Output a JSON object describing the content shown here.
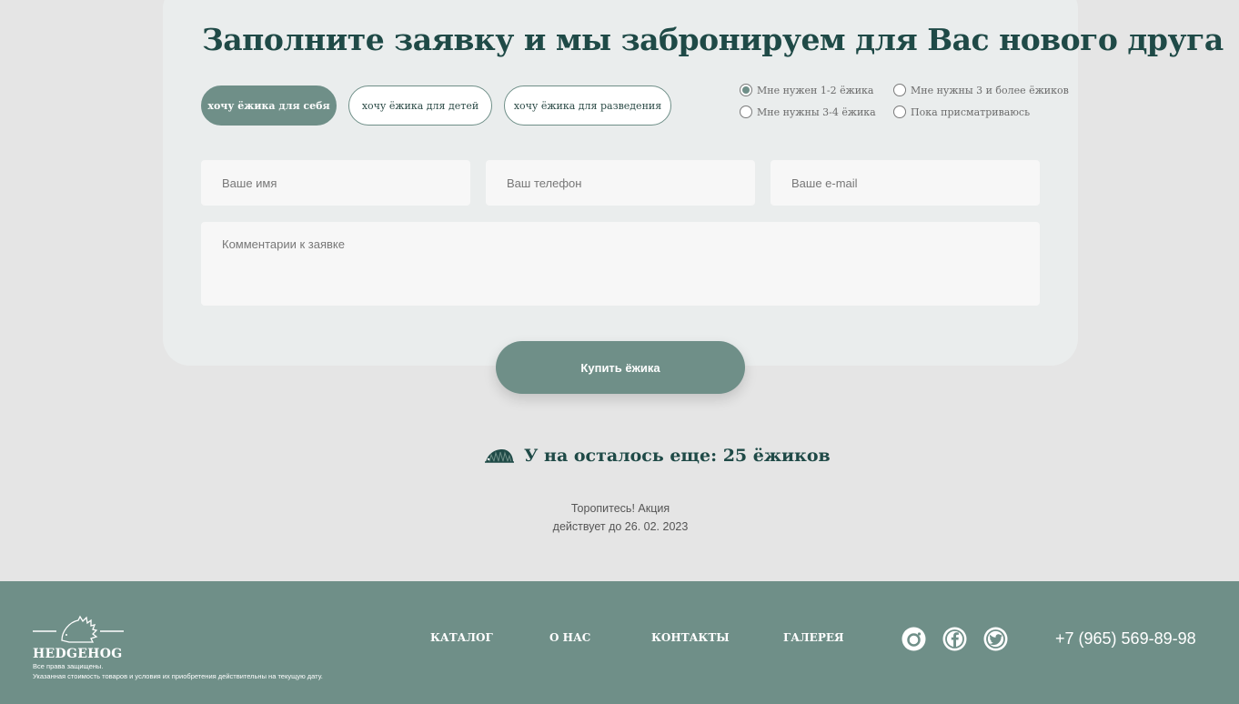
{
  "form": {
    "title": "Заполните заявку и мы забронируем для Вас нового друга",
    "purpose_buttons": [
      {
        "label": "хочу ёжика для себя",
        "active": true
      },
      {
        "label": "хочу ёжика для детей",
        "active": false
      },
      {
        "label": "хочу ёжика для разведения",
        "active": false
      }
    ],
    "quantity_options": [
      {
        "label": "Мне нужен 1-2 ёжика",
        "checked": true
      },
      {
        "label": "Мне нужны 3 и более ёжиков",
        "checked": false
      },
      {
        "label": "Мне нужны 3-4 ёжика",
        "checked": false
      },
      {
        "label": "Пока присматриваюсь",
        "checked": false
      }
    ],
    "name_placeholder": "Ваше имя",
    "phone_placeholder": "Ваш телефон",
    "email_placeholder": "Ваше e-mail",
    "comment_placeholder": "Комментарии к заявке",
    "submit_label": "Купить ёжика"
  },
  "stock": {
    "text": "У на осталось еще: 25 ёжиков",
    "promo_line1": "Торопитесь! Акция",
    "promo_line2": "действует до 26. 02. 2023"
  },
  "footer": {
    "brand": "HEDGEHOG",
    "rights": "Все права защищены.",
    "disclaimer": "Указанная стоимость товаров и условия их приобретения действительны на текущую дату.",
    "nav": [
      "КАТАЛОГ",
      "О НАС",
      "КОНТАКТЫ",
      "ГАЛЕРЕЯ"
    ],
    "social_icons": [
      "instagram-icon",
      "facebook-icon",
      "twitter-icon"
    ],
    "phone": "+7 (965) 569-89-98"
  },
  "colors": {
    "accent": "#6f8f88",
    "heading": "#1f4a47",
    "page_bg": "#e5e5e5",
    "card_bg": "#eaeded"
  }
}
